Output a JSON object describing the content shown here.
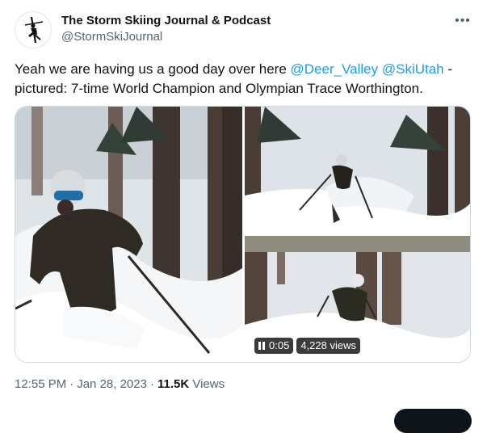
{
  "account": {
    "display_name": "The Storm Skiing Journal & Podcast",
    "handle": "@StormSkiJournal",
    "avatar_icon": "skier-logo-icon"
  },
  "menu": {
    "more_label": "•••"
  },
  "tweet": {
    "text_before": "Yeah we are having us a good day over here ",
    "mention1": "@Deer_Valley",
    "mention2": "@SkiUtah",
    "text_after": " - pictured: 7-time World Champion and Olympian Trace Worthington."
  },
  "video": {
    "time": "0:05",
    "views": "4,228 views"
  },
  "meta": {
    "time": "12:55 PM",
    "date": "Jan 28, 2023",
    "views_count": "11.5K",
    "views_label": "Views",
    "separator": "·"
  },
  "colors": {
    "link": "#1d9bf0",
    "secondary_text": "#536471",
    "primary_text": "#0f1419"
  }
}
